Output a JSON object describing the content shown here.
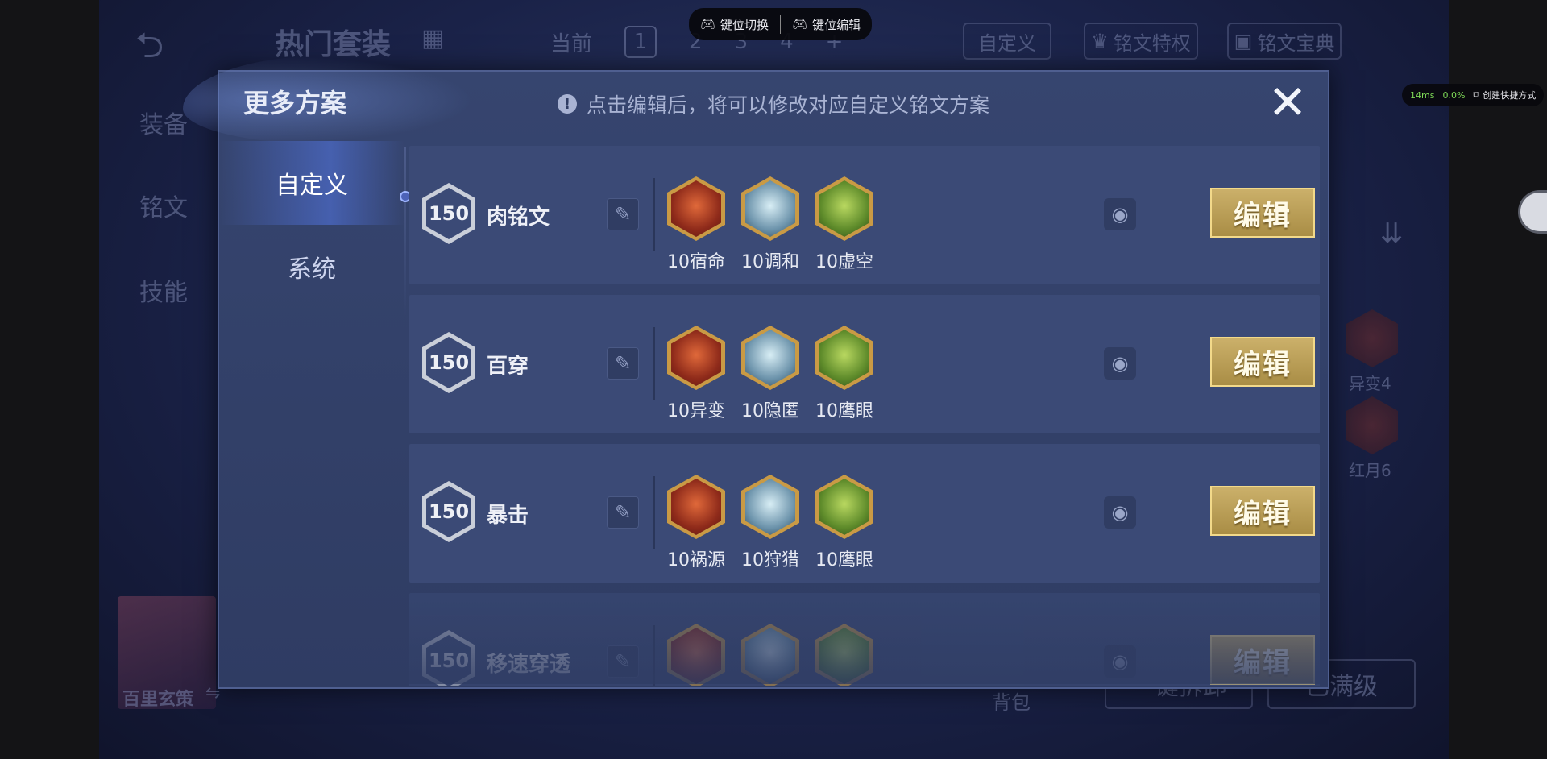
{
  "background": {
    "hot_sets": "热门套装",
    "current_label": "当前",
    "slots": [
      "1",
      "2",
      "3",
      "4",
      "+"
    ],
    "custom": "自定义",
    "privilege": "铭文特权",
    "codex": "铭文宝典",
    "left_nav": [
      "装备",
      "铭文",
      "技能"
    ],
    "hero_name": "百里玄策",
    "rune_labels": [
      "异变4",
      "红月6"
    ],
    "bag": "背包",
    "one_key": "一键拆卸",
    "max_level": "已满级"
  },
  "modal": {
    "title": "更多方案",
    "hint": "点击编辑后，将可以修改对应自定义铭文方案",
    "close": "✕",
    "nav": [
      {
        "label": "自定义",
        "active": true
      },
      {
        "label": "系统",
        "active": false
      }
    ],
    "edit_label": "编辑",
    "plans": [
      {
        "level": "150",
        "name": "肉铭文",
        "runes": [
          {
            "label": "10宿命",
            "color": "red"
          },
          {
            "label": "10调和",
            "color": "blue"
          },
          {
            "label": "10虚空",
            "color": "green"
          }
        ]
      },
      {
        "level": "150",
        "name": "百穿",
        "runes": [
          {
            "label": "10异变",
            "color": "red"
          },
          {
            "label": "10隐匿",
            "color": "blue"
          },
          {
            "label": "10鹰眼",
            "color": "green"
          }
        ]
      },
      {
        "level": "150",
        "name": "暴击",
        "runes": [
          {
            "label": "10祸源",
            "color": "red"
          },
          {
            "label": "10狩猎",
            "color": "blue"
          },
          {
            "label": "10鹰眼",
            "color": "green"
          }
        ]
      },
      {
        "level": "150",
        "name": "移速穿透",
        "runes": [
          {
            "label": "",
            "color": "red"
          },
          {
            "label": "",
            "color": "blue"
          },
          {
            "label": "",
            "color": "green"
          }
        ]
      }
    ]
  },
  "overlay": {
    "key_switch": "键位切换",
    "key_edit": "键位编辑",
    "latency": "14ms",
    "loss": "0.0%",
    "shortcut": "创建快捷方式"
  },
  "colors": {
    "gold": "#cbb06a",
    "panel": "#36456f",
    "accent": "#5a7cff"
  }
}
